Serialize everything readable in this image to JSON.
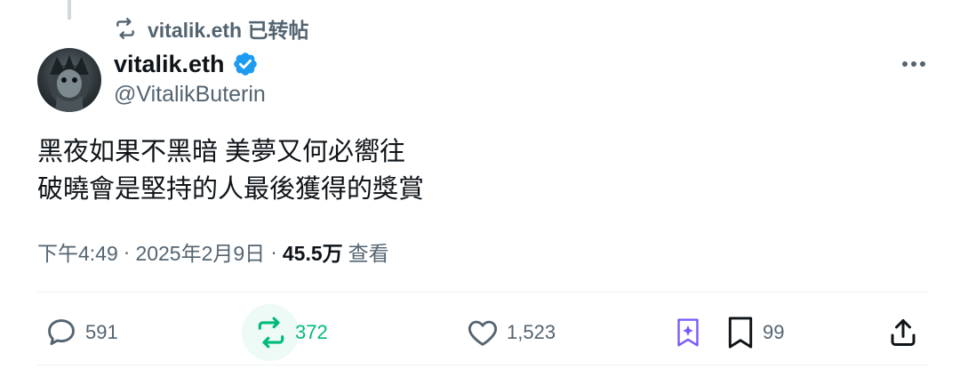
{
  "repost_header": {
    "text": "vitalik.eth 已转帖",
    "icon": "repost-icon"
  },
  "author": {
    "display_name": "vitalik.eth",
    "handle": "@VitalikButerin",
    "verified_icon": "verified-badge-icon",
    "verified_color": "#1d9bf0"
  },
  "tweet": {
    "lines": [
      "黑夜如果不黑暗 美夢又何必嚮往",
      "破曉會是堅持的人最後獲得的獎賞"
    ]
  },
  "meta": {
    "time": "下午4:49",
    "separator": "·",
    "date": "2025年2月9日",
    "views_count": "45.5万",
    "views_label": "查看"
  },
  "actions": {
    "replies": "591",
    "reposts": "372",
    "likes": "1,523",
    "bookmarks": "99",
    "repost_color": "#00ba7c",
    "grok_color": "#7856ff"
  }
}
